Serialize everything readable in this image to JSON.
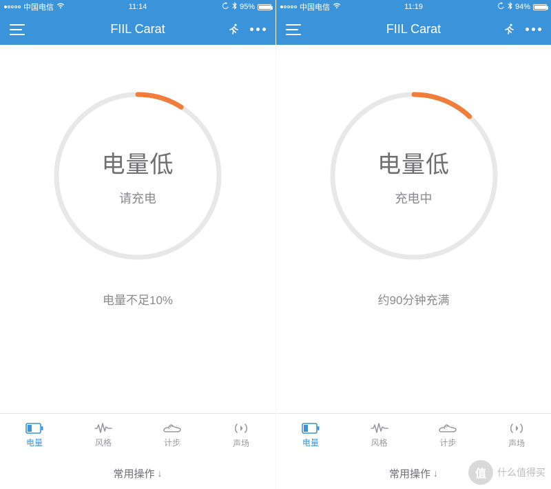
{
  "colors": {
    "brand": "#3b94d9",
    "accent": "#f27d3a",
    "ring_track": "#e8e8e8",
    "muted": "#8a8a8f"
  },
  "screens": [
    {
      "status": {
        "carrier": "中国电信",
        "time": "11:14",
        "battery_pct": "95%",
        "battery_fill": 0.95,
        "signal_filled": 1
      },
      "nav": {
        "title": "FIIL Carat"
      },
      "battery_ring": {
        "pct": 0.09,
        "title": "电量低",
        "subtitle": "请充电"
      },
      "caption": "电量不足10%"
    },
    {
      "status": {
        "carrier": "中国电信",
        "time": "11:19",
        "battery_pct": "94%",
        "battery_fill": 0.94,
        "signal_filled": 1
      },
      "nav": {
        "title": "FIIL Carat"
      },
      "battery_ring": {
        "pct": 0.12,
        "title": "电量低",
        "subtitle": "充电中"
      },
      "caption": "约90分钟充满"
    }
  ],
  "tabs": [
    {
      "id": "battery",
      "label": "电量",
      "active": true
    },
    {
      "id": "style",
      "label": "风格",
      "active": false
    },
    {
      "id": "steps",
      "label": "计步",
      "active": false
    },
    {
      "id": "sound",
      "label": "声场",
      "active": false
    }
  ],
  "drawer_label": "常用操作",
  "watermark_text": "什么值得买"
}
